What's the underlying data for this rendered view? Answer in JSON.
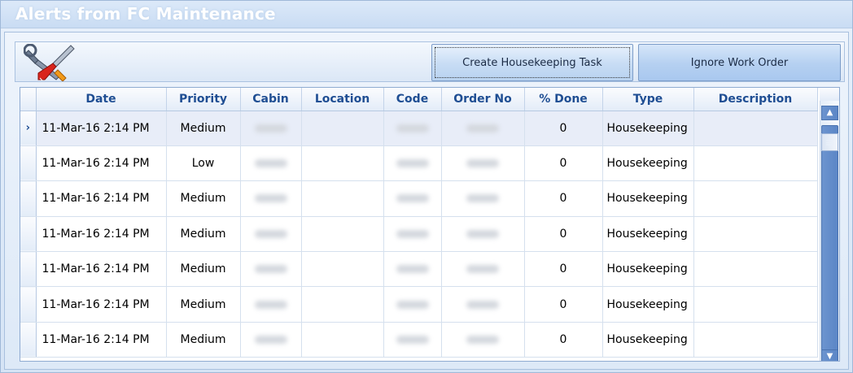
{
  "window": {
    "title": "Alerts from FC Maintenance"
  },
  "toolbar": {
    "icon": "tools-icon",
    "create_label": "Create Housekeeping Task",
    "ignore_label": "Ignore Work Order"
  },
  "grid": {
    "columns": [
      "Date",
      "Priority",
      "Cabin",
      "Location",
      "Code",
      "Order No",
      "% Done",
      "Type",
      "Description"
    ],
    "rows": [
      {
        "date": "11-Mar-16 2:14 PM",
        "priority": "Medium",
        "done": "0",
        "type": "Housekeeping",
        "selected_marker": "›"
      },
      {
        "date": "11-Mar-16 2:14 PM",
        "priority": "Low",
        "done": "0",
        "type": "Housekeeping",
        "selected_marker": ""
      },
      {
        "date": "11-Mar-16 2:14 PM",
        "priority": "Medium",
        "done": "0",
        "type": "Housekeeping",
        "selected_marker": ""
      },
      {
        "date": "11-Mar-16 2:14 PM",
        "priority": "Medium",
        "done": "0",
        "type": "Housekeeping",
        "selected_marker": ""
      },
      {
        "date": "11-Mar-16 2:14 PM",
        "priority": "Medium",
        "done": "0",
        "type": "Housekeeping",
        "selected_marker": ""
      },
      {
        "date": "11-Mar-16 2:14 PM",
        "priority": "Medium",
        "done": "0",
        "type": "Housekeeping",
        "selected_marker": ""
      },
      {
        "date": "11-Mar-16 2:14 PM",
        "priority": "Medium",
        "done": "0",
        "type": "Housekeeping",
        "selected_marker": ""
      }
    ]
  },
  "colors": {
    "header_text": "#1f4e93",
    "scroll_thumb": "#5b86c6",
    "selected_row": "#e8edf8"
  }
}
